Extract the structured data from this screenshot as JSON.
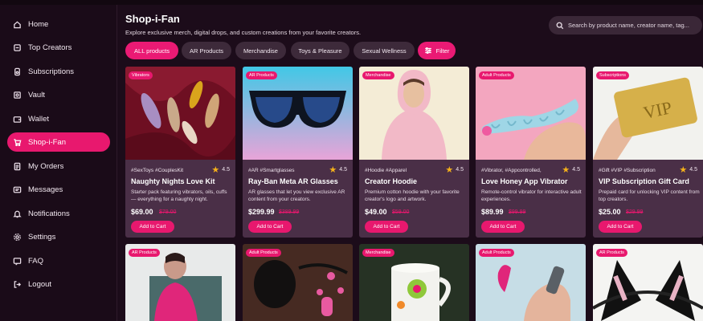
{
  "sidebar": {
    "items": [
      {
        "label": "Home",
        "icon": "home-icon"
      },
      {
        "label": "Top Creators",
        "icon": "creators-icon"
      },
      {
        "label": "Subscriptions",
        "icon": "subscriptions-icon"
      },
      {
        "label": "Vault",
        "icon": "vault-icon"
      },
      {
        "label": "Wallet",
        "icon": "wallet-icon"
      },
      {
        "label": "Shop-i-Fan",
        "icon": "shop-icon",
        "active": true
      },
      {
        "label": "My Orders",
        "icon": "orders-icon"
      },
      {
        "label": "Messages",
        "icon": "messages-icon"
      },
      {
        "label": "Notifications",
        "icon": "bell-icon"
      },
      {
        "label": "Settings",
        "icon": "gear-icon"
      },
      {
        "label": "FAQ",
        "icon": "faq-icon"
      },
      {
        "label": "Logout",
        "icon": "logout-icon"
      }
    ]
  },
  "header": {
    "title": "Shop-i-Fan",
    "subtitle": "Explore exclusive merch, digital drops, and custom creations from your favorite creators.",
    "search_placeholder": "Search by product name, creator name, tag..."
  },
  "filters": {
    "chips": [
      "ALL products",
      "AR Products",
      "Merchandise",
      "Toys & Pleasure",
      "Sexual Wellness"
    ],
    "active": "ALL products",
    "filter_label": "Filter"
  },
  "products": [
    {
      "badge": "Vibrators",
      "tags": "#SexToys #CouplesKit",
      "rating": "4.5",
      "name": "Naughty Nights Love Kit",
      "desc": "Starter pack featuring vibrators, oils, cuffs — everything for a naughty night.",
      "price": "$69.00",
      "old_price": "$79.00",
      "cart": "Add to Cart"
    },
    {
      "badge": "AR Products",
      "tags": "#AR #Smartglasses",
      "rating": "4.5",
      "name": "Ray-Ban Meta AR Glasses",
      "desc": "AR glasses that let you view exclusive AR content from your creators.",
      "price": "$299.99",
      "old_price": "$389.99",
      "cart": "Add to Cart"
    },
    {
      "badge": "Merchandise",
      "tags": "#Hoodie #Apparel",
      "rating": "4.5",
      "name": "Creator Hoodie",
      "desc": "Premium cotton hoodie with your favorite creator's logo and artwork.",
      "price": "$49.00",
      "old_price": "$59.00",
      "cart": "Add to Cart"
    },
    {
      "badge": "Adult Products",
      "tags": "#Vibrator, #Appcontrolled,",
      "rating": "4.5",
      "name": "Love Honey App Vibrator",
      "desc": "Remote-control vibrator for interactive adult experiences.",
      "price": "$89.99",
      "old_price": "$99.99",
      "cart": "Add to Cart"
    },
    {
      "badge": "Subscriptions",
      "tags": "#Gift #VIP #Subscription",
      "rating": "4.5",
      "name": "VIP Subscription Gift Card",
      "desc": "Prepaid card for unlocking VIP content from top creators.",
      "price": "$25.00",
      "old_price": "$29.99",
      "cart": "Add to Cart"
    }
  ],
  "products_row2": [
    {
      "badge": "AR Products"
    },
    {
      "badge": "Adult Products"
    },
    {
      "badge": "Merchandise"
    },
    {
      "badge": "Adult Products"
    },
    {
      "badge": "AR Products"
    }
  ],
  "gift_card_text": "VIP",
  "colors": {
    "accent": "#e8186e",
    "background": "#1c0c1a",
    "card": "#4a2f47",
    "star": "#f6b21a"
  }
}
